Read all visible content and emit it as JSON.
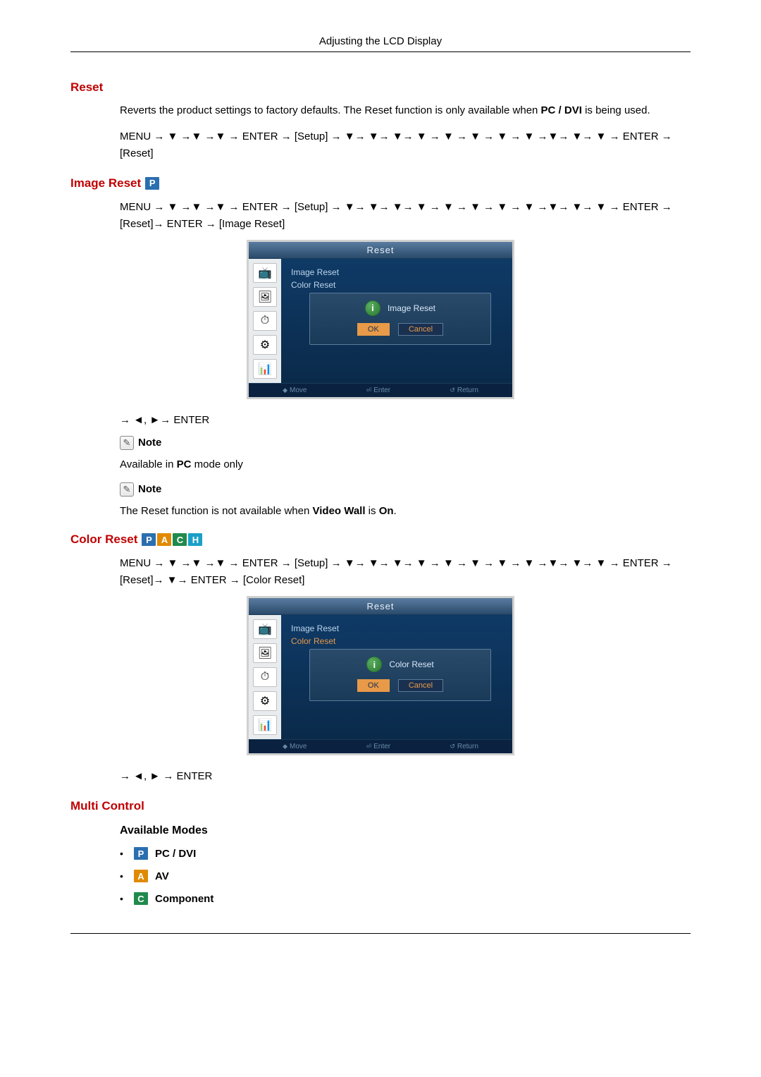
{
  "page_header": "Adjusting the LCD Display",
  "sections": {
    "reset": {
      "title": "Reset",
      "desc_pre": "Reverts the product settings to factory defaults. The Reset function is only available when ",
      "desc_bold": "PC / DVI",
      "desc_post": " is being used.",
      "path": "MENU → ▼ →▼ →▼ → ENTER → [Setup] → ▼→ ▼→ ▼→ ▼ → ▼ → ▼ → ▼ → ▼ →▼→ ▼→ ▼ → ENTER → [Reset]"
    },
    "image_reset": {
      "title": "Image Reset",
      "path": "MENU → ▼ →▼ →▼ → ENTER → [Setup] → ▼→ ▼→ ▼→ ▼ → ▼ → ▼ → ▼ → ▼ →▼→ ▼→ ▼ → ENTER → [Reset]→ ENTER → [Image Reset]",
      "osd": {
        "title": "Reset",
        "items": [
          "Image Reset",
          "Color Reset"
        ],
        "dialog_title": "Image Reset",
        "ok": "OK",
        "cancel": "Cancel",
        "footer": {
          "move": "Move",
          "enter": "Enter",
          "return": "Return"
        }
      },
      "after_path": "→ ◄, ►→ ENTER",
      "note1_label": "Note",
      "note1_text_pre": "Available in ",
      "note1_text_bold": "PC",
      "note1_text_post": " mode only",
      "note2_label": "Note",
      "note2_pre": "The Reset function is not available when ",
      "note2_b1": "Video Wall",
      "note2_mid": " is ",
      "note2_b2": "On",
      "note2_post": "."
    },
    "color_reset": {
      "title": "Color Reset",
      "path": "MENU → ▼ →▼ →▼ → ENTER → [Setup] → ▼→ ▼→ ▼→ ▼ → ▼ → ▼ → ▼ → ▼ →▼→ ▼→ ▼ → ENTER → [Reset]→ ▼→ ENTER → [Color Reset]",
      "osd": {
        "title": "Reset",
        "items": [
          "Image Reset",
          "Color Reset"
        ],
        "dialog_title": "Color Reset",
        "ok": "OK",
        "cancel": "Cancel",
        "footer": {
          "move": "Move",
          "enter": "Enter",
          "return": "Return"
        }
      },
      "after_path": "→ ◄, ► → ENTER"
    },
    "multi_control": {
      "title": "Multi Control",
      "subheading": "Available Modes",
      "modes": [
        {
          "badge": "P",
          "label": "PC / DVI"
        },
        {
          "badge": "A",
          "label": "AV"
        },
        {
          "badge": "C",
          "label": "Component"
        }
      ]
    }
  }
}
